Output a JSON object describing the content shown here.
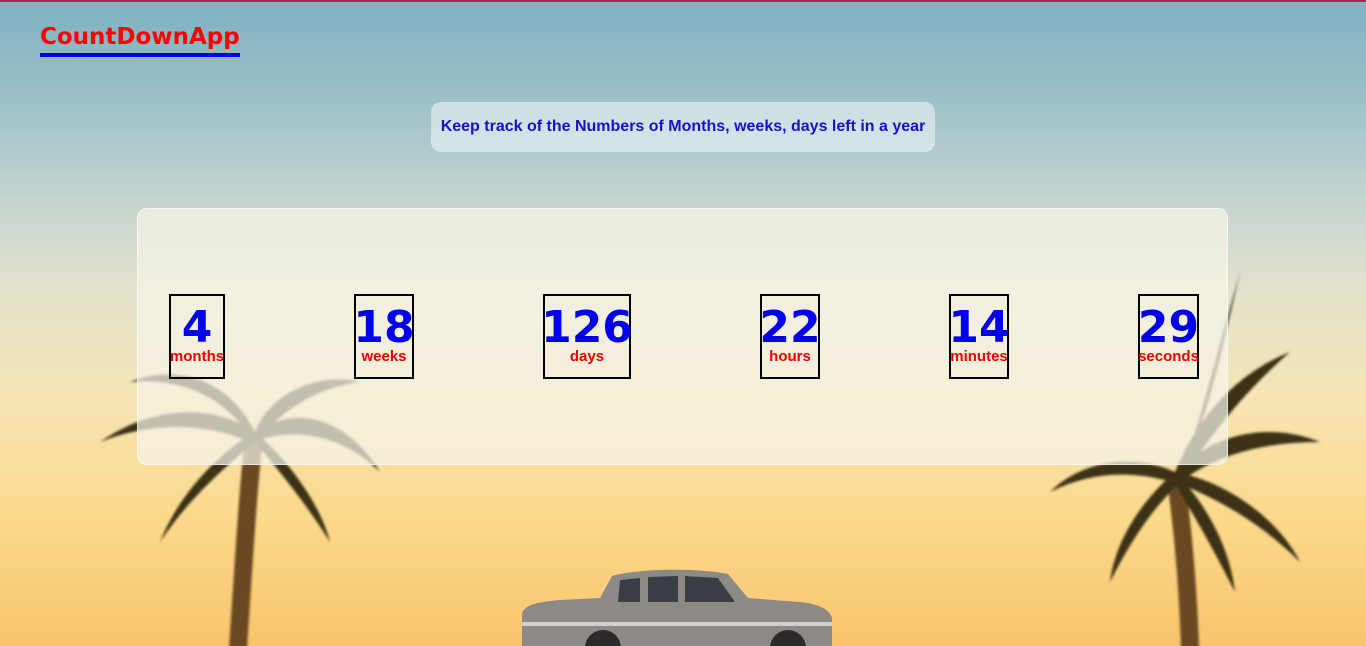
{
  "header": {
    "logo": "CountDownApp"
  },
  "tagline": "Keep track of the Numbers of Months, weeks, days left in a year",
  "countdown": [
    {
      "value": "4",
      "label": "months"
    },
    {
      "value": "18",
      "label": "weeks"
    },
    {
      "value": "126",
      "label": "days"
    },
    {
      "value": "22",
      "label": "hours"
    },
    {
      "value": "14",
      "label": "minutes"
    },
    {
      "value": "29",
      "label": "seconds"
    }
  ],
  "colors": {
    "accent_red": "#ff0000",
    "accent_blue": "#0000ee",
    "top_border": "#b0265a"
  },
  "background_image": "palm-trees-and-vintage-car-sunset"
}
